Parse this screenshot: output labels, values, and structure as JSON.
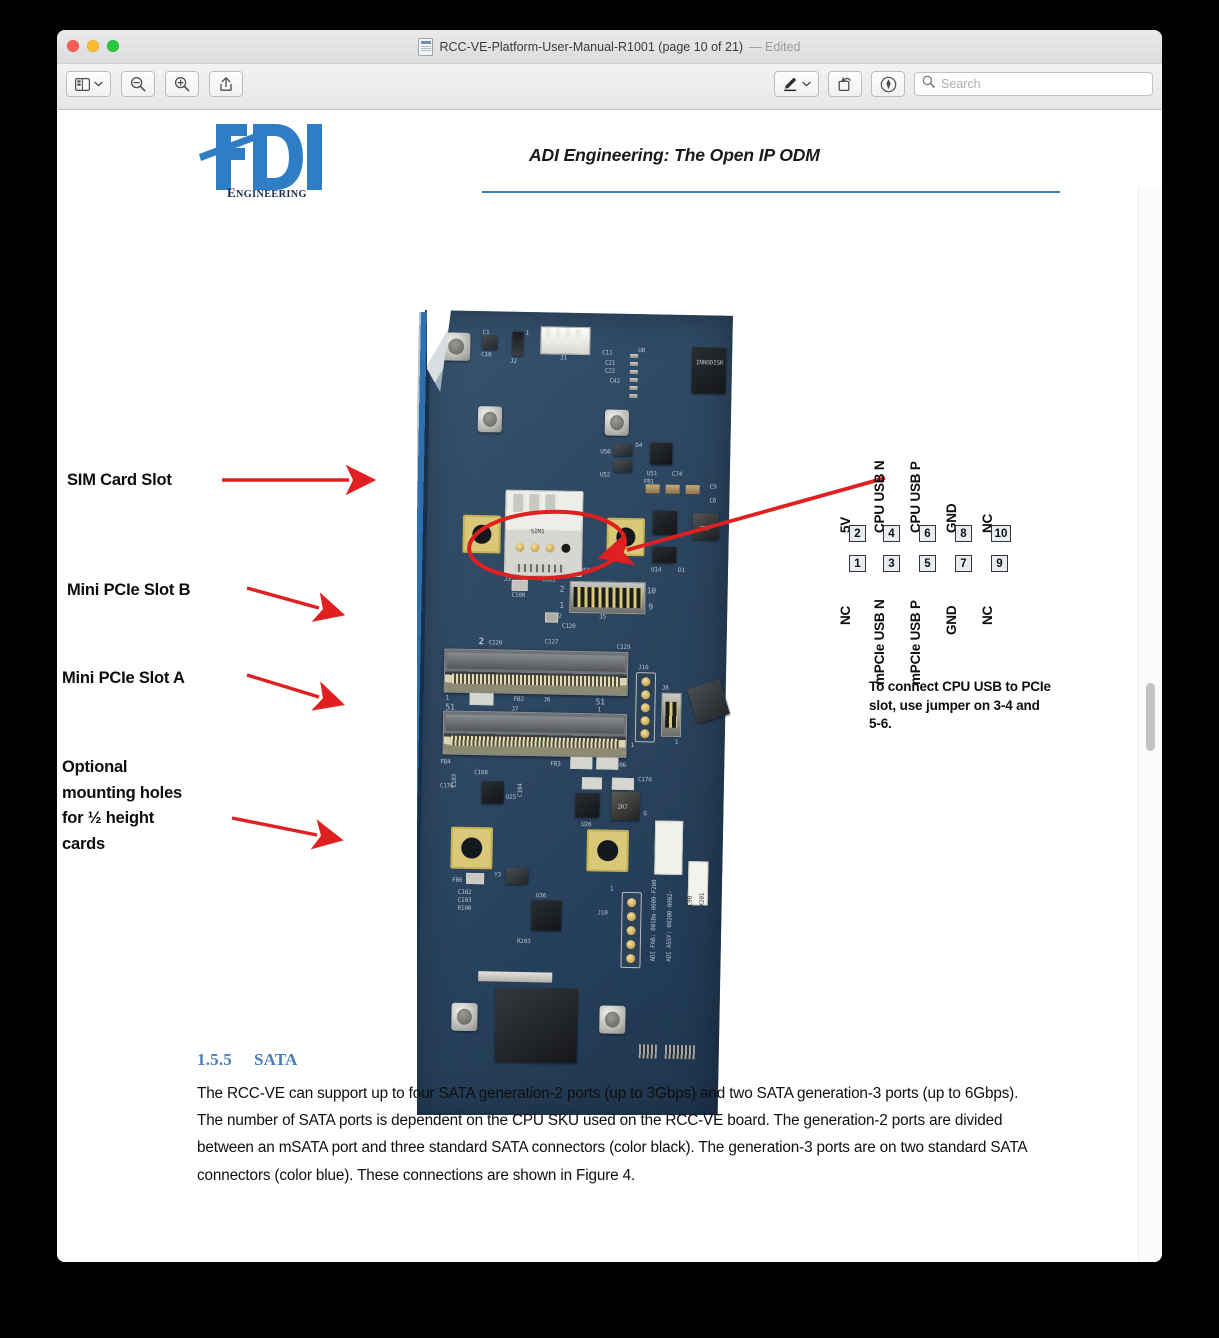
{
  "window": {
    "title": "RCC-VE-Platform-User-Manual-R1001 (page 10 of 21)",
    "edited_label": "— Edited",
    "doc_icon": "pdf-document-icon"
  },
  "toolbar": {
    "sidebar_button": "sidebar-icon",
    "sidebar_chevron": "chevron-down-icon",
    "zoom_out_button": "zoom-out-icon",
    "zoom_in_button": "zoom-in-icon",
    "share_button": "share-icon",
    "markup_button": "markup-pen-icon",
    "markup_chevron": "chevron-down-icon",
    "rotate_button": "rotate-icon",
    "annotate_button": "annotate-icon",
    "search": {
      "icon": "search-icon",
      "placeholder": "Search",
      "value": ""
    }
  },
  "document": {
    "header": {
      "logo_text": "ADI",
      "logo_subtext": "ENGINEERING",
      "title": "ADI Engineering:  The Open IP ODM"
    },
    "figure": {
      "callouts": [
        {
          "label": "SIM Card Slot"
        },
        {
          "label": "Mini PCIe Slot B"
        },
        {
          "label": "Mini PCIe Slot A"
        },
        {
          "label": "Optional\nmounting holes\nfor ½ height\ncards"
        }
      ],
      "pin_diagram": {
        "top_row": [
          {
            "pin": "2",
            "label": "5V"
          },
          {
            "pin": "4",
            "label": "CPU USB N"
          },
          {
            "pin": "6",
            "label": "CPU USB P"
          },
          {
            "pin": "8",
            "label": "GND"
          },
          {
            "pin": "10",
            "label": "NC"
          }
        ],
        "bottom_row": [
          {
            "pin": "1",
            "label": "NC"
          },
          {
            "pin": "3",
            "label": "mPCIe USB N"
          },
          {
            "pin": "5",
            "label": "mPCIe USB P"
          },
          {
            "pin": "7",
            "label": "GND"
          },
          {
            "pin": "9",
            "label": "NC"
          }
        ],
        "note": "To connect CPU USB to PCIe slot, use jumper on 3-4 and 5-6."
      },
      "board_silkscreen": [
        "C10",
        "J2",
        "J1",
        "C11",
        "C21",
        "C22",
        "U50",
        "U52",
        "U51",
        "C74",
        "SIM1",
        "C105",
        "C100",
        "U14",
        "D1",
        "J5",
        "J3",
        "J4",
        "USB",
        "2",
        "C120",
        "C127",
        "C129",
        "1",
        "51",
        "FB2",
        "J6",
        "J7",
        "FB1",
        "C103",
        "C108",
        "C104",
        "FB3",
        "C106",
        "C170",
        "U25",
        "U26",
        "J10",
        "J8",
        "C102",
        "C103",
        "R100",
        "U36",
        "R203",
        "C176",
        "C90",
        "X201",
        "ADI FAB: 001Ba-0009-F200",
        "ADI ASSY: 00200-0002-"
      ]
    },
    "section": {
      "number": "1.5.5",
      "title": "SATA",
      "body": "The RCC-VE can support up to four SATA generation-2 ports (up to 3Gbps) and two SATA generation-3 ports (up to 6Gbps).  The number of SATA ports is dependent on the CPU SKU used on the RCC-VE board.  The generation-2 ports are divided between an mSATA port and three standard SATA connectors (color black).  The generation-3 ports are on two standard SATA connectors (color blue).  These connections are shown in Figure 4."
    }
  },
  "colors": {
    "accent_blue": "#4a7ebb",
    "rule_blue": "#3a7fc4",
    "annotation_red": "#e02020",
    "pcb_blue": "#2a4663",
    "pad_yellow": "#d8c878"
  }
}
